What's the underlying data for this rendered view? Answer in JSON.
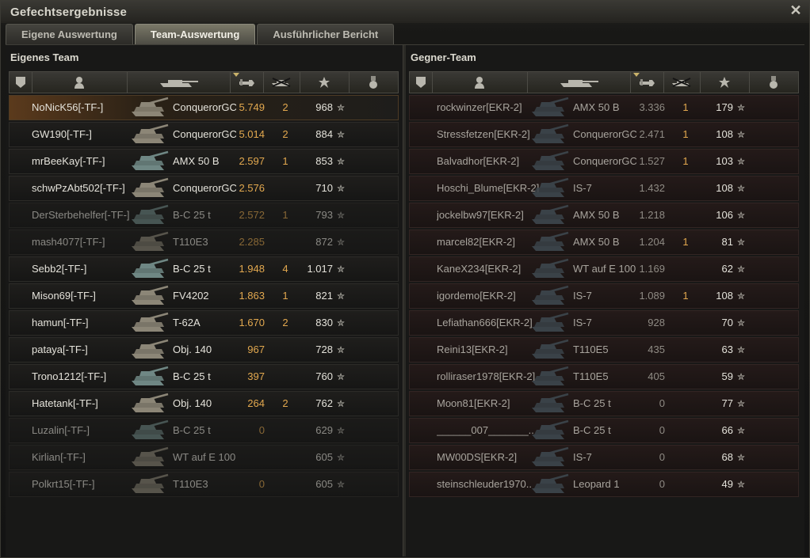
{
  "window": {
    "title": "Gefechtsergebnisse"
  },
  "tabs": [
    {
      "label": "Eigene Auswertung",
      "active": false
    },
    {
      "label": "Team-Auswertung",
      "active": true
    },
    {
      "label": "Ausführlicher Bericht",
      "active": false
    }
  ],
  "columns": [
    "platoon-icon",
    "player-icon",
    "tank-icon",
    "damage-icon",
    "kills-icon",
    "experience-icon",
    "medal-icon"
  ],
  "star_glyph": "✮",
  "own_team": {
    "title": "Eigenes Team",
    "rows": [
      {
        "name": "NoNicK56[-TF-]",
        "tank": "ConquerorGC",
        "damage": "5.749",
        "kills": "2",
        "xp": "968",
        "alive": true,
        "highlight": true
      },
      {
        "name": "GW190[-TF-]",
        "tank": "ConquerorGC",
        "damage": "5.014",
        "kills": "2",
        "xp": "884",
        "alive": true
      },
      {
        "name": "mrBeeKay[-TF-]",
        "tank": "AMX 50 B",
        "damage": "2.597",
        "kills": "1",
        "xp": "853",
        "alive": true
      },
      {
        "name": "schwPzAbt502[-TF-]",
        "tank": "ConquerorGC",
        "damage": "2.576",
        "kills": "",
        "xp": "710",
        "alive": true
      },
      {
        "name": "DerSterbehelfer[-TF-]",
        "tank": "B-C 25 t",
        "damage": "2.572",
        "kills": "1",
        "xp": "793",
        "alive": false
      },
      {
        "name": "mash4077[-TF-]",
        "tank": "T110E3",
        "damage": "2.285",
        "kills": "",
        "xp": "872",
        "alive": false
      },
      {
        "name": "Sebb2[-TF-]",
        "tank": "B-C 25 t",
        "damage": "1.948",
        "kills": "4",
        "xp": "1.017",
        "alive": true
      },
      {
        "name": "Mison69[-TF-]",
        "tank": "FV4202",
        "damage": "1.863",
        "kills": "1",
        "xp": "821",
        "alive": true
      },
      {
        "name": "hamun[-TF-]",
        "tank": "T-62A",
        "damage": "1.670",
        "kills": "2",
        "xp": "830",
        "alive": true
      },
      {
        "name": "pataya[-TF-]",
        "tank": "Obj. 140",
        "damage": "967",
        "kills": "",
        "xp": "728",
        "alive": true
      },
      {
        "name": "Trono1212[-TF-]",
        "tank": "B-C 25 t",
        "damage": "397",
        "kills": "",
        "xp": "760",
        "alive": true
      },
      {
        "name": "Hatetank[-TF-]",
        "tank": "Obj. 140",
        "damage": "264",
        "kills": "2",
        "xp": "762",
        "alive": true
      },
      {
        "name": "Luzalin[-TF-]",
        "tank": "B-C 25 t",
        "damage": "0",
        "kills": "",
        "xp": "629",
        "alive": false
      },
      {
        "name": "Kirlian[-TF-]",
        "tank": "WT auf E 100",
        "damage": "",
        "kills": "",
        "xp": "605",
        "alive": false
      },
      {
        "name": "Polkrt15[-TF-]",
        "tank": "T110E3",
        "damage": "0",
        "kills": "",
        "xp": "605",
        "alive": false
      }
    ]
  },
  "enemy_team": {
    "title": "Gegner-Team",
    "rows": [
      {
        "name": "rockwinzer[EKR-2]",
        "tank": "AMX 50 B",
        "damage": "3.336",
        "kills": "1",
        "xp": "179"
      },
      {
        "name": "Stressfetzen[EKR-2]",
        "tank": "ConquerorGC",
        "damage": "2.471",
        "kills": "1",
        "xp": "108"
      },
      {
        "name": "Balvadhor[EKR-2]",
        "tank": "ConquerorGC",
        "damage": "1.527",
        "kills": "1",
        "xp": "103"
      },
      {
        "name": "Hoschi_Blume[EKR-2]",
        "tank": "IS-7",
        "damage": "1.432",
        "kills": "",
        "xp": "108"
      },
      {
        "name": "jockelbw97[EKR-2]",
        "tank": "AMX 50 B",
        "damage": "1.218",
        "kills": "",
        "xp": "106"
      },
      {
        "name": "marcel82[EKR-2]",
        "tank": "AMX 50 B",
        "damage": "1.204",
        "kills": "1",
        "xp": "81"
      },
      {
        "name": "KaneX234[EKR-2]",
        "tank": "WT auf E 100",
        "damage": "1.169",
        "kills": "",
        "xp": "62"
      },
      {
        "name": "igordemo[EKR-2]",
        "tank": "IS-7",
        "damage": "1.089",
        "kills": "1",
        "xp": "108"
      },
      {
        "name": "Lefiathan666[EKR-2]",
        "tank": "IS-7",
        "damage": "928",
        "kills": "",
        "xp": "70"
      },
      {
        "name": "Reini13[EKR-2]",
        "tank": "T110E5",
        "damage": "435",
        "kills": "",
        "xp": "63"
      },
      {
        "name": "rolliraser1978[EKR-2]",
        "tank": "T110E5",
        "damage": "405",
        "kills": "",
        "xp": "59"
      },
      {
        "name": "Moon81[EKR-2]",
        "tank": "B-C 25 t",
        "damage": "0",
        "kills": "",
        "xp": "77"
      },
      {
        "name": "______007_______..",
        "tank": "B-C 25 t",
        "damage": "0",
        "kills": "",
        "xp": "66"
      },
      {
        "name": "MW00DS[EKR-2]",
        "tank": "IS-7",
        "damage": "0",
        "kills": "",
        "xp": "68"
      },
      {
        "name": "steinschleuder1970..",
        "tank": "Leopard 1",
        "damage": "0",
        "kills": "",
        "xp": "49"
      }
    ]
  }
}
